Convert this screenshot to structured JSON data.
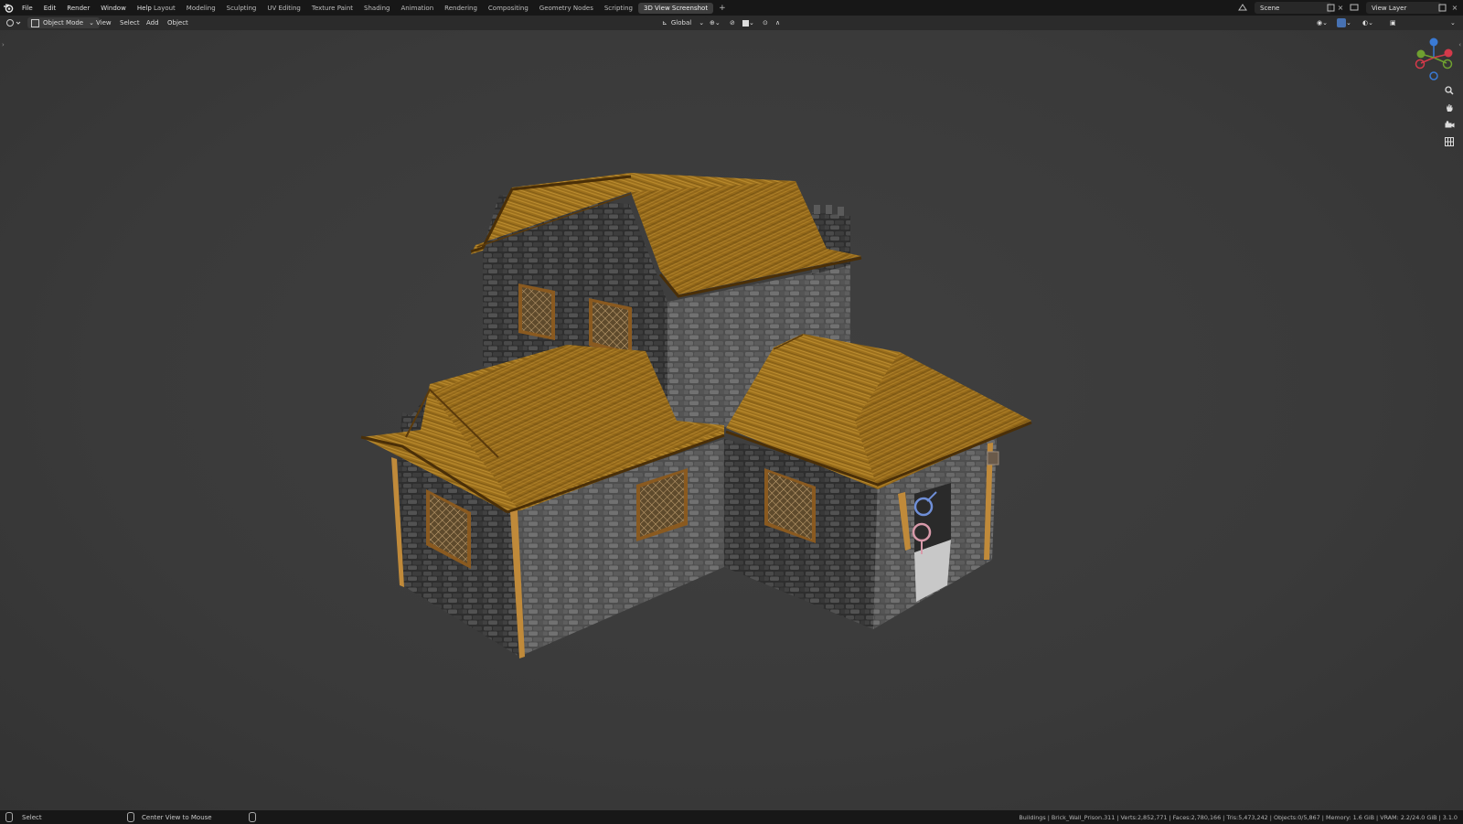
{
  "menu": {
    "items": [
      "File",
      "Edit",
      "Render",
      "Window",
      "Help"
    ]
  },
  "workspace_tabs": [
    {
      "label": "Layout",
      "active": false
    },
    {
      "label": "Modeling",
      "active": false
    },
    {
      "label": "Sculpting",
      "active": false
    },
    {
      "label": "UV Editing",
      "active": false
    },
    {
      "label": "Texture Paint",
      "active": false
    },
    {
      "label": "Shading",
      "active": false
    },
    {
      "label": "Animation",
      "active": false
    },
    {
      "label": "Rendering",
      "active": false
    },
    {
      "label": "Compositing",
      "active": false
    },
    {
      "label": "Geometry Nodes",
      "active": false
    },
    {
      "label": "Scripting",
      "active": false
    },
    {
      "label": "3D View Screenshot",
      "active": true
    }
  ],
  "scene": {
    "name": "Scene"
  },
  "view_layer": {
    "name": "View Layer"
  },
  "viewport_header": {
    "mode": "Object Mode",
    "menus": [
      "View",
      "Select",
      "Add",
      "Object"
    ],
    "transform_orientation": "Global"
  },
  "statusbar": {
    "left_action": "Select",
    "middle_action": "Center View to Mouse",
    "info": "Buildings | Brick_Wall_Prison.311 | Verts:2,852,771 | Faces:2,780,166 | Tris:5,473,242 | Objects:0/5,867 | Memory: 1.6 GiB | VRAM: 2.2/24.0 GiB | 3.1.0"
  },
  "icons": {
    "app_logo": "blender-logo-icon",
    "zoom": "magnifier-icon",
    "pan": "hand-icon",
    "camera": "camera-icon",
    "ortho": "grid-icon"
  },
  "colors": {
    "topbar_bg": "#171717",
    "viewport_bg": "#3d3d3d",
    "accent_active": "#4772b3",
    "axis_x": "#d43a4a",
    "axis_y": "#6fa030",
    "axis_z": "#3a7ad4"
  }
}
